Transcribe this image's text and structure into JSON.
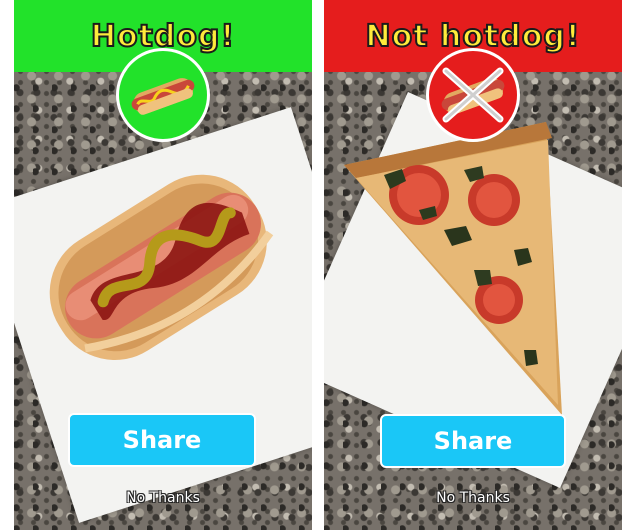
{
  "left_screen": {
    "result_label": "Hotdog!",
    "badge_icon": "hotdog-icon",
    "share_label": "Share",
    "dismiss_label": "No Thanks",
    "banner_color": "#22e22a"
  },
  "right_screen": {
    "result_label": "Not hotdog!",
    "badge_icon": "hotdog-crossed-icon",
    "share_label": "Share",
    "dismiss_label": "No Thanks",
    "banner_color": "#e51d1d"
  },
  "colors": {
    "banner_text": "#ffeb3b",
    "share_button": "#1ac7f7"
  }
}
